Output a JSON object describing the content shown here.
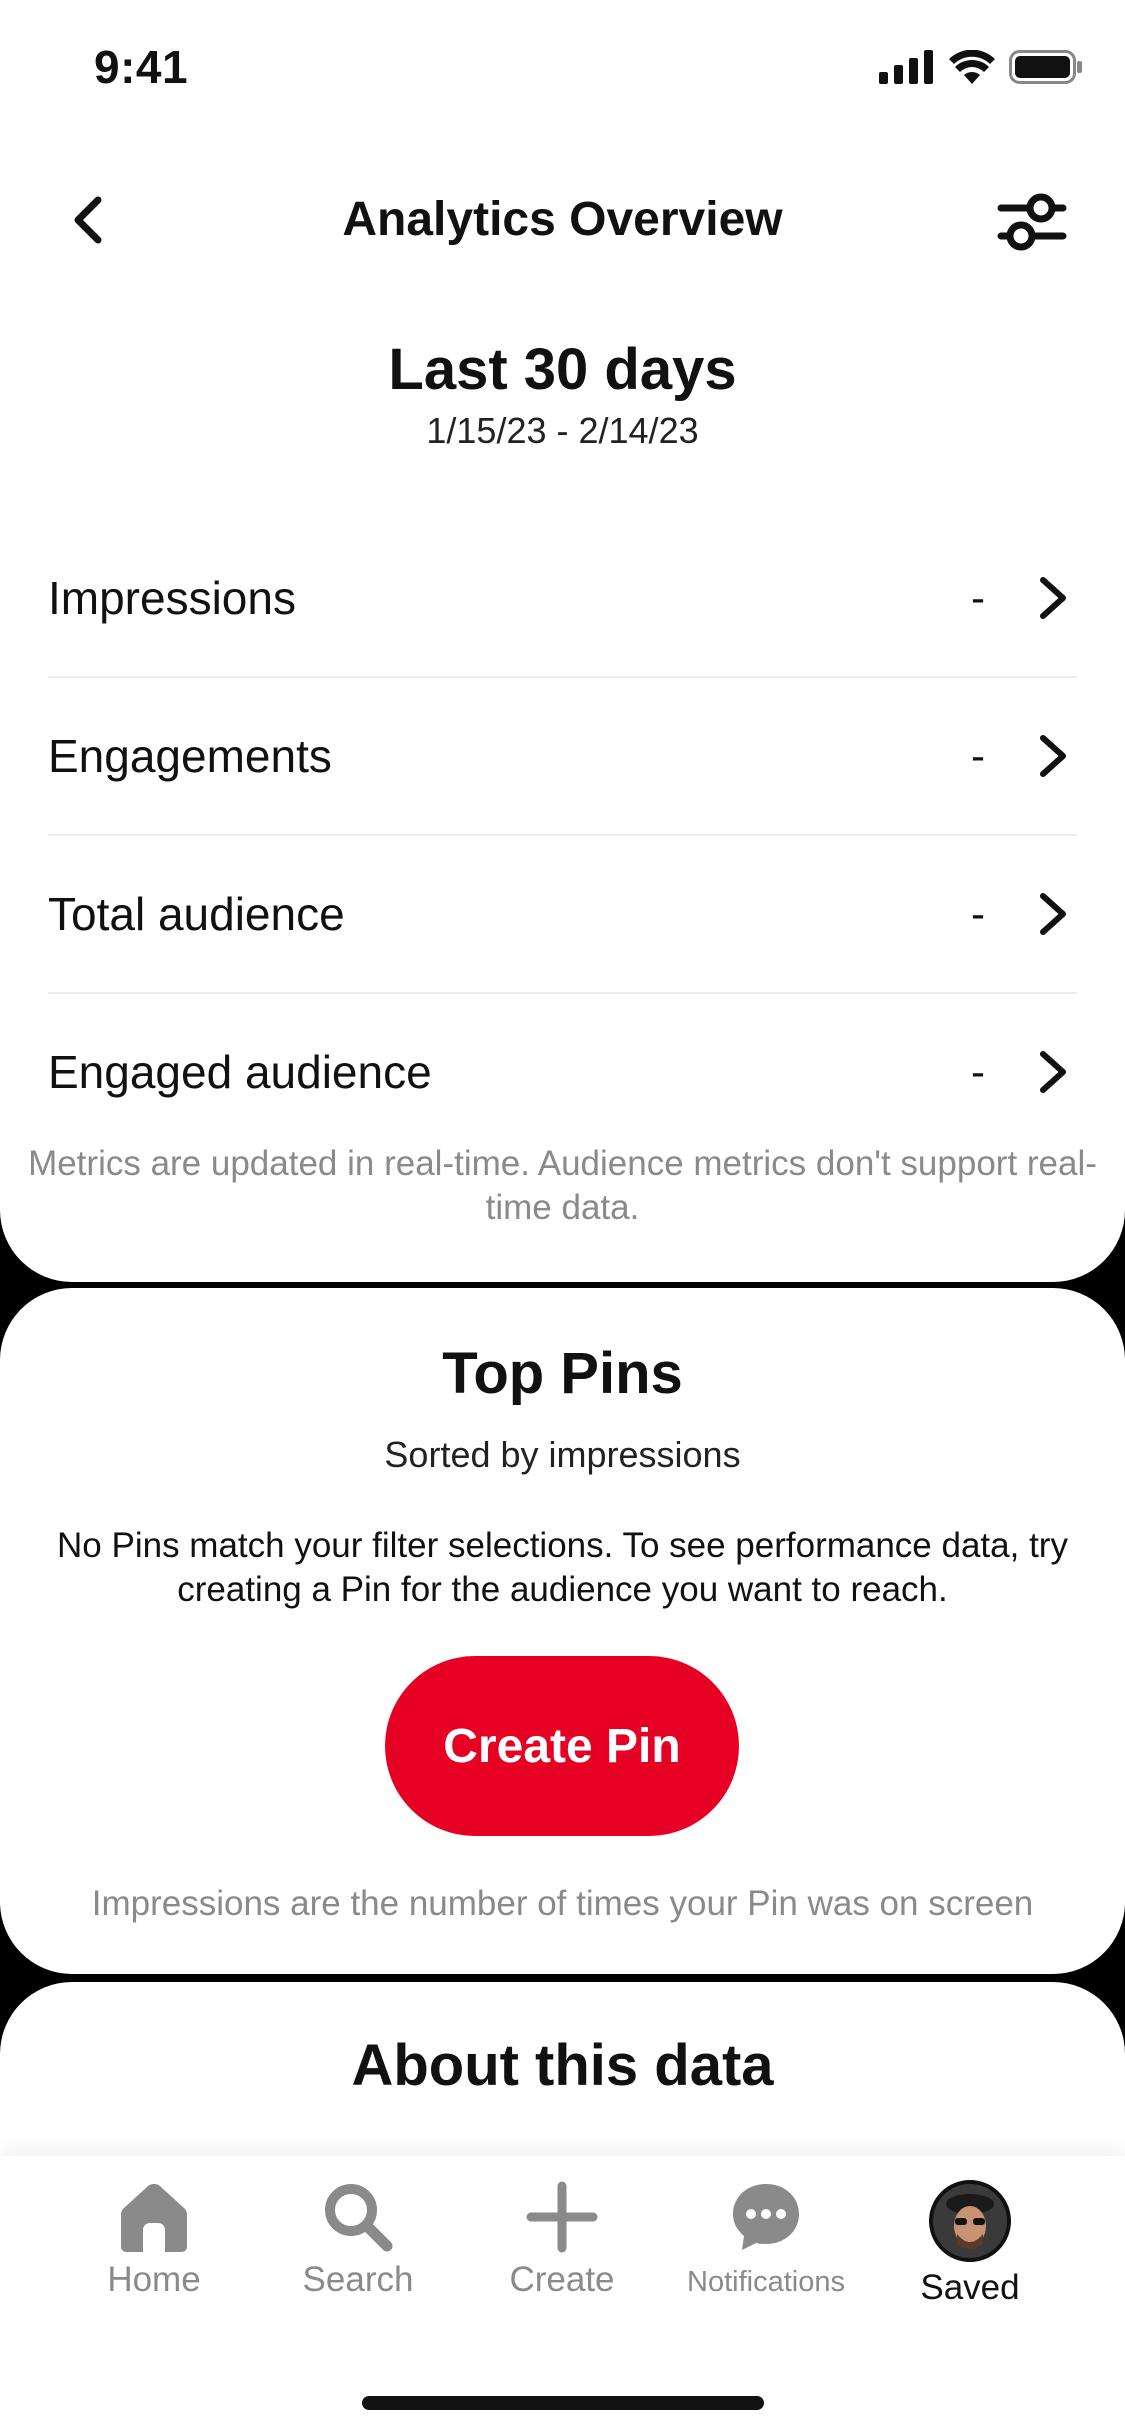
{
  "status_bar": {
    "time": "9:41"
  },
  "header": {
    "title": "Analytics Overview"
  },
  "date_range": {
    "title": "Last 30 days",
    "dates": "1/15/23 - 2/14/23"
  },
  "metrics": [
    {
      "label": "Impressions",
      "value": "-"
    },
    {
      "label": "Engagements",
      "value": "-"
    },
    {
      "label": "Total audience",
      "value": "-"
    },
    {
      "label": "Engaged audience",
      "value": "-"
    }
  ],
  "metrics_note": "Metrics are updated in real-time. Audience metrics don't support real-time data.",
  "top_pins": {
    "title": "Top Pins",
    "subtitle": "Sorted by impressions",
    "empty_message": "No Pins match your filter selections. To see performance data, try creating a Pin for the audience you want to reach.",
    "create_button": "Create Pin",
    "note": "Impressions are the number of times your Pin was on screen"
  },
  "about": {
    "title": "About this data"
  },
  "tabbar": {
    "items": [
      {
        "label": "Home",
        "icon": "home-icon"
      },
      {
        "label": "Search",
        "icon": "search-icon"
      },
      {
        "label": "Create",
        "icon": "plus-icon"
      },
      {
        "label": "Notifications",
        "icon": "chat-bubble-icon"
      },
      {
        "label": "Saved",
        "icon": "avatar",
        "active": true
      }
    ]
  },
  "colors": {
    "accent": "#e60023",
    "muted_text": "#8a8a8a",
    "background": "#000000"
  }
}
